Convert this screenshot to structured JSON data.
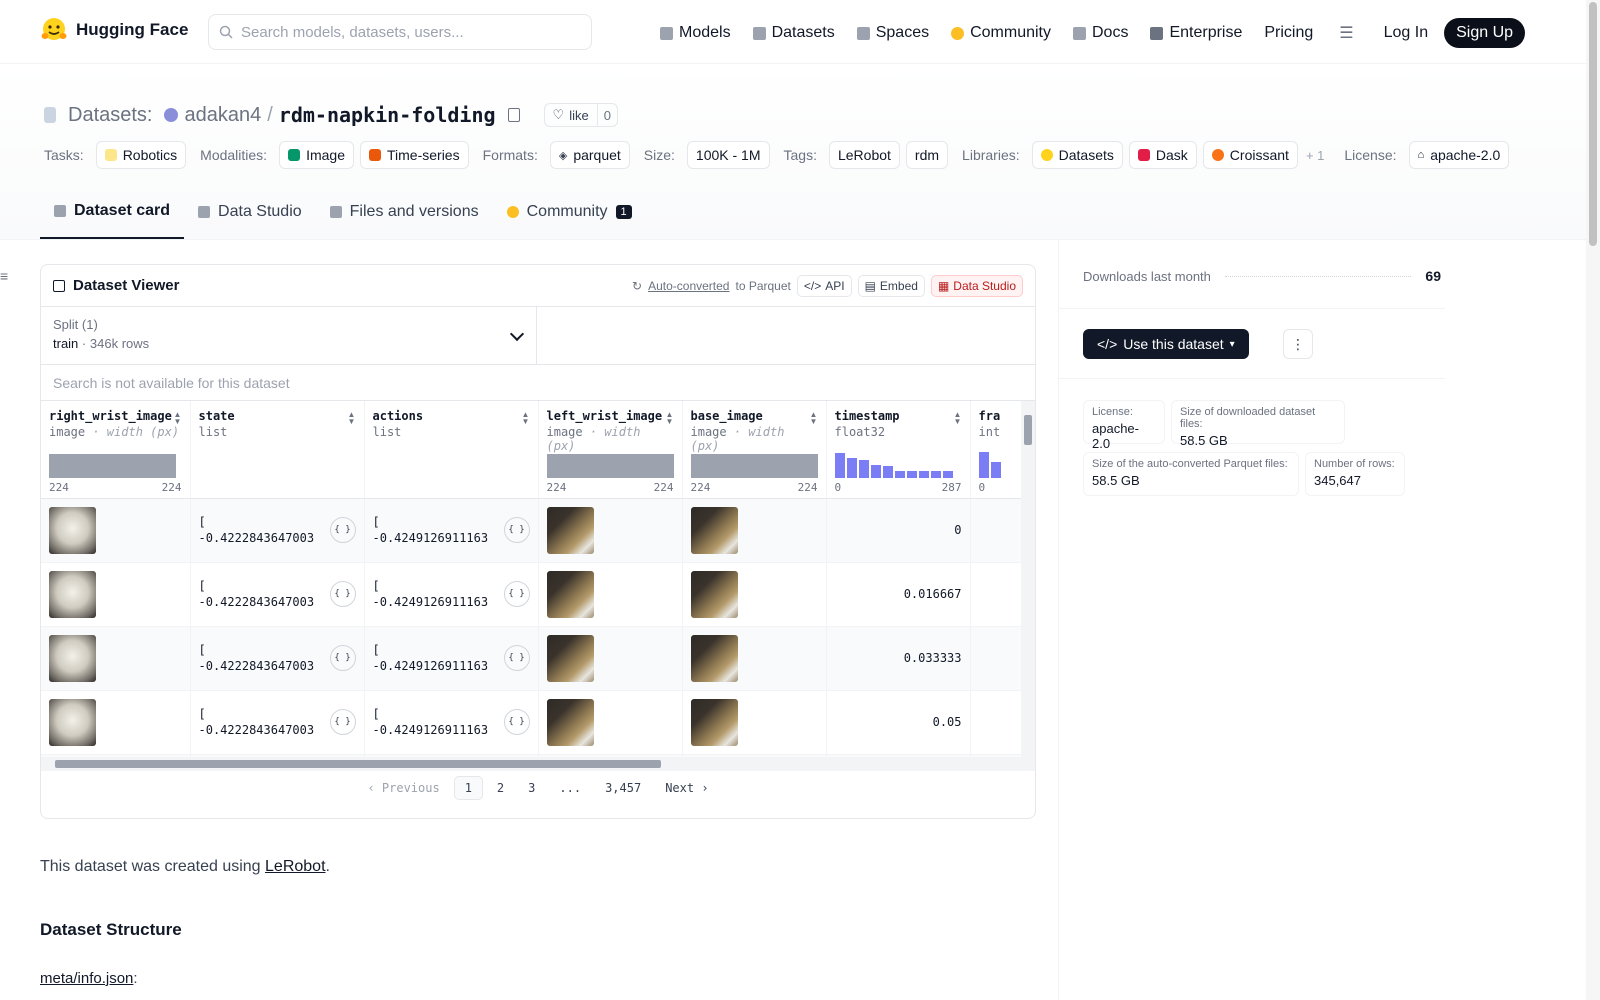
{
  "nav": {
    "brand": "Hugging Face",
    "search_placeholder": "Search models, datasets, users...",
    "links": [
      "Models",
      "Datasets",
      "Spaces",
      "Community",
      "Docs",
      "Enterprise",
      "Pricing"
    ],
    "login": "Log In",
    "signup": "Sign Up"
  },
  "header": {
    "section_label": "Datasets:",
    "owner": "adakan4",
    "separator": "/",
    "repo": "rdm-napkin-folding",
    "like_label": "like",
    "like_count": "0",
    "tags": {
      "tasks_label": "Tasks:",
      "tasks": [
        "Robotics"
      ],
      "modalities_label": "Modalities:",
      "modalities": [
        "Image",
        "Time-series"
      ],
      "formats_label": "Formats:",
      "formats": [
        "parquet"
      ],
      "size_label": "Size:",
      "size": [
        "100K - 1M"
      ],
      "tags_label": "Tags:",
      "tags": [
        "LeRobot",
        "rdm"
      ],
      "libraries_label": "Libraries:",
      "libraries": [
        "Datasets",
        "Dask",
        "Croissant"
      ],
      "libraries_more": "+ 1",
      "license_label": "License:",
      "license": "apache-2.0"
    },
    "tabs": [
      "Dataset card",
      "Data Studio",
      "Files and versions",
      "Community"
    ],
    "community_count": "1"
  },
  "viewer": {
    "title": "Dataset Viewer",
    "auto_converted": "Auto-converted",
    "to_parquet": "to Parquet",
    "api": "API",
    "embed": "Embed",
    "data_studio": "Data Studio",
    "split_label": "Split (1)",
    "split_name": "train",
    "split_dot": "·",
    "split_rows": "346k rows",
    "search_na": "Search is not available for this dataset",
    "columns": [
      {
        "name": "right_wrist_image",
        "type": "image",
        "extra": "· width (px)",
        "min": "224",
        "max": "224"
      },
      {
        "name": "state",
        "type": "list",
        "extra": "",
        "min": "",
        "max": ""
      },
      {
        "name": "actions",
        "type": "list",
        "extra": "",
        "min": "",
        "max": ""
      },
      {
        "name": "left_wrist_image",
        "type": "image",
        "extra": "· width (px)",
        "min": "224",
        "max": "224"
      },
      {
        "name": "base_image",
        "type": "image",
        "extra": "· width (px)",
        "min": "224",
        "max": "224"
      },
      {
        "name": "timestamp",
        "type": "float32",
        "extra": "",
        "min": "0",
        "max": "287"
      },
      {
        "name": "fra",
        "type": "int",
        "extra": "",
        "min": "0",
        "max": ""
      }
    ],
    "timestamp_histogram": [
      0.95,
      0.75,
      0.7,
      0.5,
      0.45,
      0.25,
      0.25,
      0.25,
      0.25,
      0.25
    ],
    "frame_histogram": [
      1.0,
      0.6
    ],
    "rows": [
      {
        "state": "[\n-0.4222843647003...",
        "actions": "[\n-0.4249126911163...",
        "timestamp": "0"
      },
      {
        "state": "[\n-0.4222843647003...",
        "actions": "[\n-0.4249126911163...",
        "timestamp": "0.016667"
      },
      {
        "state": "[\n-0.4222843647003...",
        "actions": "[\n-0.4249126911163...",
        "timestamp": "0.033333"
      },
      {
        "state": "[\n-0.4222843647003...",
        "actions": "[\n-0.4249126911163...",
        "timestamp": "0.05"
      }
    ],
    "pager": {
      "previous": "Previous",
      "pages": [
        "1",
        "2",
        "3",
        "...",
        "3,457"
      ],
      "next": "Next"
    }
  },
  "sidebar": {
    "downloads_label": "Downloads last month",
    "downloads_value": "69",
    "use_dataset": "Use this dataset",
    "stats": [
      {
        "label": "License:",
        "value": "apache-2.0"
      },
      {
        "label": "Size of downloaded dataset files:",
        "value": "58.5 GB"
      },
      {
        "label": "Size of the auto-converted Parquet files:",
        "value": "58.5 GB"
      },
      {
        "label": "Number of rows:",
        "value": "345,647"
      }
    ]
  },
  "content": {
    "created_prefix": "This dataset was created using",
    "created_link": "LeRobot",
    "created_suffix": ".",
    "structure_heading": "Dataset Structure",
    "meta_link": "meta/info.json",
    "meta_suffix": ":"
  },
  "colors": {
    "accent": "#6366f1",
    "dark": "#111827",
    "hf_yellow": "#ffd21e"
  }
}
